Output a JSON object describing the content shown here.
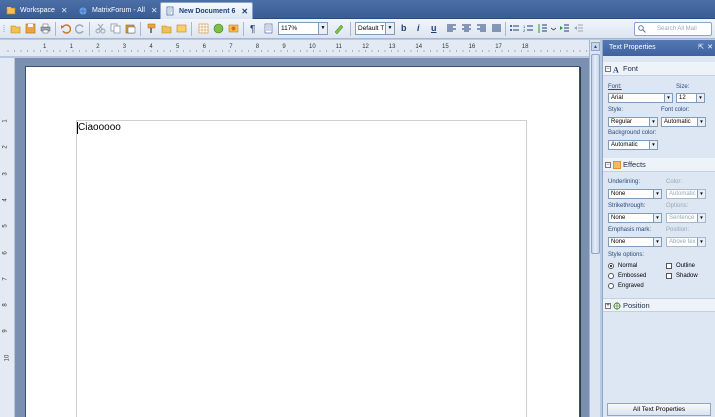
{
  "tabs": [
    {
      "label": "Workspace",
      "icon": "workspace-icon"
    },
    {
      "label": "MatrixForum - All",
      "icon": "globe-icon"
    },
    {
      "label": "New Document 6",
      "icon": "document-icon"
    }
  ],
  "toolbar": {
    "zoom": "117%",
    "style": "Default T",
    "bold": "b",
    "italic": "i",
    "underline": "u",
    "search_placeholder": "Search All Mail"
  },
  "ruler": {
    "numbers": [
      "1",
      "1",
      "2",
      "3",
      "4",
      "5",
      "6",
      "7",
      "8",
      "9",
      "10",
      "11",
      "12",
      "13",
      "14",
      "15",
      "16",
      "17",
      "18"
    ]
  },
  "vruler": {
    "numbers": [
      "1",
      "2",
      "3",
      "4",
      "5",
      "6",
      "7",
      "8",
      "9",
      "10"
    ]
  },
  "document": {
    "text": "Ciaooooo"
  },
  "panel": {
    "title": "Text Properties",
    "font_section": "Font",
    "font_label": "Font:",
    "font_value": "Arial",
    "size_label": "Size:",
    "size_value": "12",
    "style_label": "Style:",
    "style_value": "Regular",
    "fontcolor_label": "Font color:",
    "fontcolor_value": "Automatic",
    "bgcolor_label": "Background color:",
    "bgcolor_value": "Automatic",
    "effects_section": "Effects",
    "underlining_label": "Underlining:",
    "underlining_value": "None",
    "color_label": "Color:",
    "color_value": "Automatic",
    "strike_label": "Strikethrough:",
    "strike_value": "None",
    "options_label": "Options:",
    "options_value": "Sentence",
    "emphasis_label": "Emphasis mark:",
    "emphasis_value": "None",
    "position_label": "Position:",
    "position_value": "Above tex",
    "styleopts_label": "Style options:",
    "opt_normal": "Normal",
    "opt_embossed": "Embossed",
    "opt_engraved": "Engraved",
    "opt_outline": "Outline",
    "opt_shadow": "Shadow",
    "position_section": "Position",
    "all_button": "All Text Properties"
  }
}
